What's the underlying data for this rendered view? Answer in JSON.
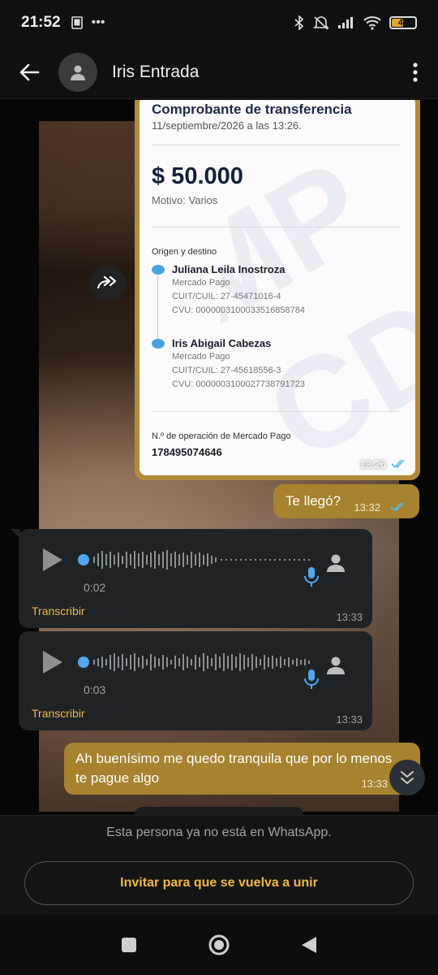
{
  "status_bar": {
    "time": "21:52",
    "battery": "49"
  },
  "header": {
    "contact_name": "Iris Entrada"
  },
  "receipt": {
    "title": "Comprobante de transferencia",
    "date": "11/septiembre/2026 a las 13:26.",
    "amount": "$ 50.000",
    "motivo": "Motivo: Varios",
    "section_label": "Origen y destino",
    "origin": {
      "name": "Juliana Leila Inostroza",
      "bank": "Mercado Pago",
      "cuit": "CUIT/CUIL: 27-45471016-4",
      "cvu": "CVU: 0000003100033516858784"
    },
    "destination": {
      "name": "Iris Abigail Cabezas",
      "bank": "Mercado Pago",
      "cuit": "CUIT/CUIL: 27-45618556-3",
      "cvu": "CVU: 0000003100027738791723"
    },
    "operation_label": "N.º de operación de Mercado Pago",
    "operation_number": "178495074646",
    "time": "13:26"
  },
  "messages": {
    "msg1": {
      "text": "Te llegó?",
      "time": "13:32"
    },
    "voice1": {
      "duration": "0:02",
      "transcribe": "Transcribir",
      "time": "13:33"
    },
    "voice2": {
      "duration": "0:03",
      "transcribe": "Transcribir",
      "time": "13:33"
    },
    "msg2": {
      "text": "Ah buenísimo me quedo tranquila que por lo menos te pague algo",
      "time": "13:33"
    }
  },
  "footer": {
    "notice": "Esta persona ya no está en WhatsApp.",
    "invite_label": "Invitar para que se vuelva a unir"
  },
  "colors": {
    "outgoing_bubble": "#a7822f",
    "incoming_bubble": "#1f2326",
    "accent_link": "#f2b845",
    "read_ticks": "#53bdeb"
  }
}
